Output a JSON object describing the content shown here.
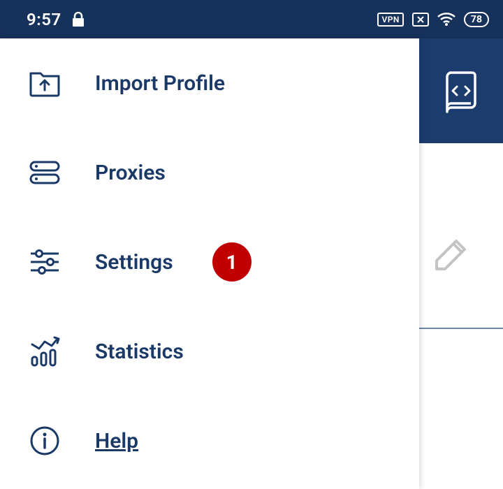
{
  "statusbar": {
    "time": "9:57",
    "vpn": "VPN",
    "battery": "78"
  },
  "menu": {
    "items": [
      {
        "icon": "import-icon",
        "label": "Import Profile"
      },
      {
        "icon": "proxies-icon",
        "label": "Proxies"
      },
      {
        "icon": "settings-icon",
        "label": "Settings",
        "badge": "1"
      },
      {
        "icon": "statistics-icon",
        "label": "Statistics"
      },
      {
        "icon": "help-icon",
        "label": "Help",
        "link": true
      }
    ]
  },
  "colors": {
    "brand_dark": "#16315a",
    "brand": "#1c3c6e",
    "ink": "#1a3966",
    "badge": "#c00000",
    "muted": "#b9b9b9"
  }
}
